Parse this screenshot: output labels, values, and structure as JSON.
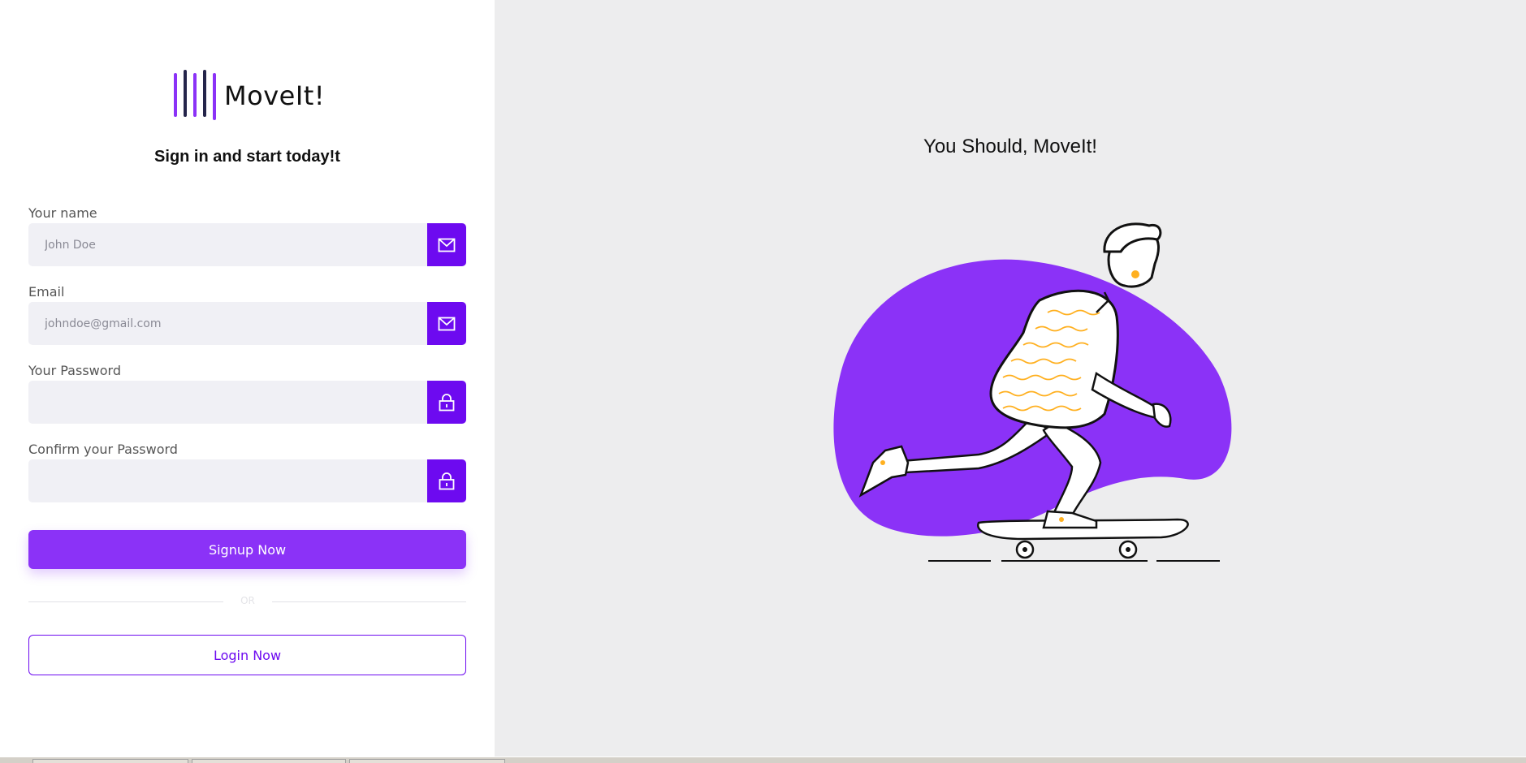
{
  "brand": {
    "name": "MoveIt!",
    "accent": "#6d0af0",
    "accent_light": "#8b32f7"
  },
  "form": {
    "subtitle": "Sign in and start today!t",
    "fields": [
      {
        "label": "Your name",
        "placeholder": "John Doe",
        "icon": "mail-icon"
      },
      {
        "label": "Email",
        "placeholder": "johndoe@gmail.com",
        "icon": "mail-icon"
      },
      {
        "label": "Your Password",
        "placeholder": "",
        "icon": "lock-icon"
      },
      {
        "label": "Confirm your Password",
        "placeholder": "",
        "icon": "lock-icon"
      }
    ],
    "signup_label": "Signup Now",
    "divider_text": "OR",
    "login_label": "Login Now"
  },
  "hero": {
    "title": "You Should, MoveIt!",
    "illustration": "skateboarder-illustration"
  }
}
